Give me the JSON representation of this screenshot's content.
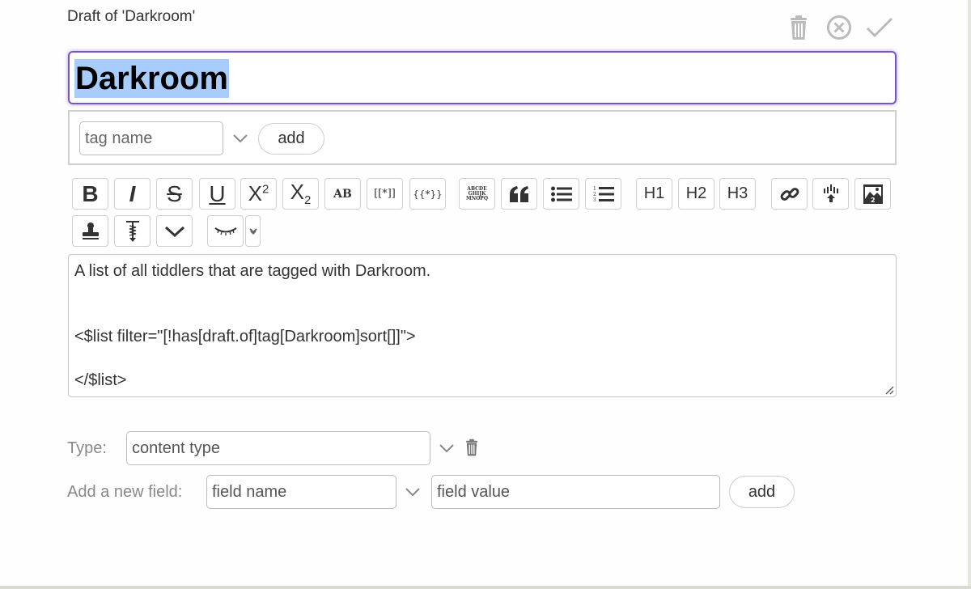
{
  "header": {
    "draft_title": "Draft of 'Darkroom'",
    "actions": [
      {
        "name": "delete",
        "icon": "trash-icon"
      },
      {
        "name": "cancel",
        "icon": "close-circle-icon"
      },
      {
        "name": "done",
        "icon": "checkmark-icon"
      }
    ]
  },
  "title_field": {
    "value": "Darkroom",
    "selected": true
  },
  "tags": {
    "input_placeholder": "tag name",
    "add_label": "add"
  },
  "toolbar": {
    "buttons": [
      {
        "name": "bold",
        "label": "B"
      },
      {
        "name": "italic",
        "label": "I"
      },
      {
        "name": "strikethrough",
        "label": "S"
      },
      {
        "name": "underline",
        "label": "U"
      },
      {
        "name": "superscript",
        "label": "X",
        "sup": "2"
      },
      {
        "name": "subscript",
        "label": "X",
        "sub": "2"
      },
      {
        "name": "smallcaps",
        "label": "AB"
      },
      {
        "name": "transclude",
        "label": "[[*]]"
      },
      {
        "name": "macro",
        "label": "{{*}}"
      },
      {
        "name": "monospace-block",
        "label": "ABCDE GHIJK MNOPQ"
      },
      {
        "name": "quote",
        "icon": "quote-icon"
      },
      {
        "name": "bullet-list",
        "icon": "bullet-list-icon"
      },
      {
        "name": "numbered-list",
        "icon": "numbered-list-icon"
      },
      {
        "name": "heading-1",
        "label": "H1"
      },
      {
        "name": "heading-2",
        "label": "H2"
      },
      {
        "name": "heading-3",
        "label": "H3"
      },
      {
        "name": "link",
        "icon": "link-icon"
      },
      {
        "name": "excise",
        "icon": "excise-icon"
      },
      {
        "name": "picture",
        "icon": "picture-icon"
      },
      {
        "name": "stamp",
        "icon": "stamp-icon"
      },
      {
        "name": "size",
        "icon": "size-icon"
      },
      {
        "name": "more",
        "icon": "chevron-down-icon"
      },
      {
        "name": "preview",
        "icon": "eye-closed-icon"
      },
      {
        "name": "preview-type",
        "icon": "small-chevron-down-icon"
      }
    ]
  },
  "body": {
    "lines": [
      "A list of all tiddlers that are tagged with Darkroom.",
      "",
      "",
      "<$list filter=\"[!has[draft.of]tag[Darkroom]sort[]]\">",
      "",
      "</$list>"
    ]
  },
  "type_field": {
    "label": "Type:",
    "placeholder": "content type"
  },
  "new_field": {
    "label": "Add a new field:",
    "name_placeholder": "field name",
    "value_placeholder": "field value",
    "add_label": "add"
  }
}
